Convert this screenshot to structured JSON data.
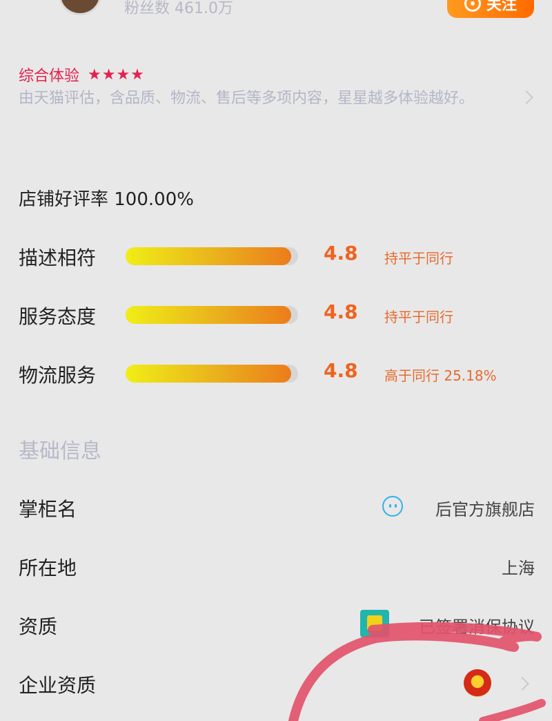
{
  "header": {
    "fans_text": "粉丝数 461.0万",
    "follow_label": "关注"
  },
  "experience": {
    "title": "综合体验",
    "stars": 4,
    "stars_text": "★★★★",
    "description": "由天猫评估，含品质、物流、售后等多项内容，星星越多体验越好。"
  },
  "ratings": {
    "good_rate_text": "店铺好评率 100.00%",
    "items": [
      {
        "label": "描述相符",
        "score": "4.8",
        "comparison": "持平于同行",
        "score_fraction": 0.96
      },
      {
        "label": "服务态度",
        "score": "4.8",
        "comparison": "持平于同行",
        "score_fraction": 0.96
      },
      {
        "label": "物流服务",
        "score": "4.8",
        "comparison": "高于同行 25.18%",
        "score_fraction": 0.96
      }
    ]
  },
  "basic_info": {
    "title": "基础信息",
    "rows": [
      {
        "label": "掌柜名",
        "value": "后官方旗舰店",
        "icon": "smiley-bot-icon"
      },
      {
        "label": "所在地",
        "value": "上海"
      },
      {
        "label": "资质",
        "value": "已签署消保协议",
        "icon": "shopping-bag-cert-icon"
      },
      {
        "label": "企业资质",
        "value": "",
        "icon": "national-emblem-icon"
      }
    ]
  },
  "colors": {
    "accent_red": "#e3224f",
    "score_orange": "#f0631e",
    "follow_orange": "#ff7a0a",
    "annotation_ink": "#e2536a"
  }
}
